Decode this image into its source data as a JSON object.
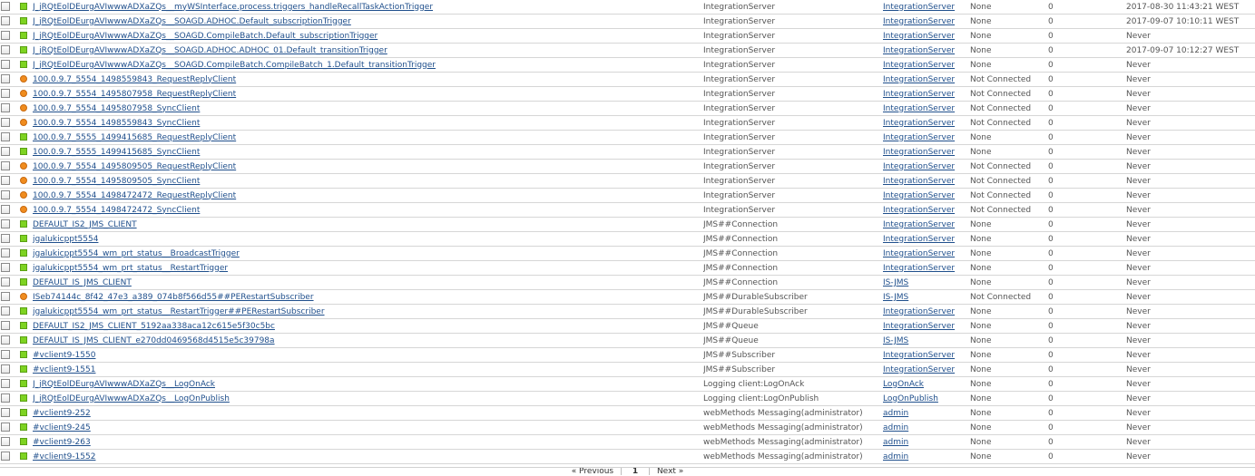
{
  "rows": [
    {
      "name": "J_jRQtEolDEurgAVIwwwADXaZQs__myWSInterface.process.triggers_handleRecallTaskActionTrigger",
      "type": "IntegrationServer",
      "realm": "IntegrationServer",
      "state": "None",
      "count": "0",
      "last": "2017-08-30 11:43:21 WEST",
      "status": "ok"
    },
    {
      "name": "J_jRQtEolDEurgAVIwwwADXaZQs__SOAGD.ADHOC.Default_subscriptionTrigger",
      "type": "IntegrationServer",
      "realm": "IntegrationServer",
      "state": "None",
      "count": "0",
      "last": "2017-09-07 10:10:11 WEST",
      "status": "ok"
    },
    {
      "name": "J_jRQtEolDEurgAVIwwwADXaZQs__SOAGD.CompileBatch.Default_subscriptionTrigger",
      "type": "IntegrationServer",
      "realm": "IntegrationServer",
      "state": "None",
      "count": "0",
      "last": "Never",
      "status": "ok"
    },
    {
      "name": "J_jRQtEolDEurgAVIwwwADXaZQs__SOAGD.ADHOC.ADHOC_01.Default_transitionTrigger",
      "type": "IntegrationServer",
      "realm": "IntegrationServer",
      "state": "None",
      "count": "0",
      "last": "2017-09-07 10:12:27 WEST",
      "status": "ok"
    },
    {
      "name": "J_jRQtEolDEurgAVIwwwADXaZQs__SOAGD.CompileBatch.CompileBatch_1.Default_transitionTrigger",
      "type": "IntegrationServer",
      "realm": "IntegrationServer",
      "state": "None",
      "count": "0",
      "last": "Never",
      "status": "ok"
    },
    {
      "name": "100.0.9.7_5554_1498559843_RequestReplyClient",
      "type": "IntegrationServer",
      "realm": "IntegrationServer",
      "state": "Not Connected",
      "count": "0",
      "last": "Never",
      "status": "warn"
    },
    {
      "name": "100.0.9.7_5554_1495807958_RequestReplyClient",
      "type": "IntegrationServer",
      "realm": "IntegrationServer",
      "state": "Not Connected",
      "count": "0",
      "last": "Never",
      "status": "warn"
    },
    {
      "name": "100.0.9.7_5554_1495807958_SyncClient",
      "type": "IntegrationServer",
      "realm": "IntegrationServer",
      "state": "Not Connected",
      "count": "0",
      "last": "Never",
      "status": "warn"
    },
    {
      "name": "100.0.9.7_5554_1498559843_SyncClient",
      "type": "IntegrationServer",
      "realm": "IntegrationServer",
      "state": "Not Connected",
      "count": "0",
      "last": "Never",
      "status": "warn"
    },
    {
      "name": "100.0.9.7_5555_1499415685_RequestReplyClient",
      "type": "IntegrationServer",
      "realm": "IntegrationServer",
      "state": "None",
      "count": "0",
      "last": "Never",
      "status": "ok"
    },
    {
      "name": "100.0.9.7_5555_1499415685_SyncClient",
      "type": "IntegrationServer",
      "realm": "IntegrationServer",
      "state": "None",
      "count": "0",
      "last": "Never",
      "status": "ok"
    },
    {
      "name": "100.0.9.7_5554_1495809505_RequestReplyClient",
      "type": "IntegrationServer",
      "realm": "IntegrationServer",
      "state": "Not Connected",
      "count": "0",
      "last": "Never",
      "status": "warn"
    },
    {
      "name": "100.0.9.7_5554_1495809505_SyncClient",
      "type": "IntegrationServer",
      "realm": "IntegrationServer",
      "state": "Not Connected",
      "count": "0",
      "last": "Never",
      "status": "warn"
    },
    {
      "name": "100.0.9.7_5554_1498472472_RequestReplyClient",
      "type": "IntegrationServer",
      "realm": "IntegrationServer",
      "state": "Not Connected",
      "count": "0",
      "last": "Never",
      "status": "warn"
    },
    {
      "name": "100.0.9.7_5554_1498472472_SyncClient",
      "type": "IntegrationServer",
      "realm": "IntegrationServer",
      "state": "Not Connected",
      "count": "0",
      "last": "Never",
      "status": "warn"
    },
    {
      "name": "DEFAULT_IS2_JMS_CLIENT",
      "type": "JMS##Connection",
      "realm": "IntegrationServer",
      "state": "None",
      "count": "0",
      "last": "Never",
      "status": "ok"
    },
    {
      "name": "jgalukicppt5554",
      "type": "JMS##Connection",
      "realm": "IntegrationServer",
      "state": "None",
      "count": "0",
      "last": "Never",
      "status": "ok"
    },
    {
      "name": "jgalukicppt5554_wm_prt_status__BroadcastTrigger",
      "type": "JMS##Connection",
      "realm": "IntegrationServer",
      "state": "None",
      "count": "0",
      "last": "Never",
      "status": "ok"
    },
    {
      "name": "jgalukicppt5554_wm_prt_status__RestartTrigger",
      "type": "JMS##Connection",
      "realm": "IntegrationServer",
      "state": "None",
      "count": "0",
      "last": "Never",
      "status": "ok"
    },
    {
      "name": "DEFAULT_IS_JMS_CLIENT",
      "type": "JMS##Connection",
      "realm": "IS-JMS",
      "state": "None",
      "count": "0",
      "last": "Never",
      "status": "ok"
    },
    {
      "name": "ISeb74144c_8f42_47e3_a389_074b8f566d55##PERestartSubscriber",
      "type": "JMS##DurableSubscriber",
      "realm": "IS-JMS",
      "state": "Not Connected",
      "count": "0",
      "last": "Never",
      "status": "warn"
    },
    {
      "name": "jgalukicppt5554_wm_prt_status__RestartTrigger##PERestartSubscriber",
      "type": "JMS##DurableSubscriber",
      "realm": "IntegrationServer",
      "state": "None",
      "count": "0",
      "last": "Never",
      "status": "ok"
    },
    {
      "name": "DEFAULT_IS2_JMS_CLIENT_5192aa338aca12c615e5f30c5bc",
      "type": "JMS##Queue",
      "realm": "IntegrationServer",
      "state": "None",
      "count": "0",
      "last": "Never",
      "status": "ok"
    },
    {
      "name": "DEFAULT_IS_JMS_CLIENT_e270dd0469568d4515e5c39798a",
      "type": "JMS##Queue",
      "realm": "IS-JMS",
      "state": "None",
      "count": "0",
      "last": "Never",
      "status": "ok"
    },
    {
      "name": "#vclient9-1550",
      "type": "JMS##Subscriber",
      "realm": "IntegrationServer",
      "state": "None",
      "count": "0",
      "last": "Never",
      "status": "ok"
    },
    {
      "name": "#vclient9-1551",
      "type": "JMS##Subscriber",
      "realm": "IntegrationServer",
      "state": "None",
      "count": "0",
      "last": "Never",
      "status": "ok"
    },
    {
      "name": "J_jRQtEolDEurgAVIwwwADXaZQs__LogOnAck",
      "type": "Logging client:LogOnAck",
      "realm": "LogOnAck",
      "state": "None",
      "count": "0",
      "last": "Never",
      "status": "ok"
    },
    {
      "name": "J_jRQtEolDEurgAVIwwwADXaZQs__LogOnPublish",
      "type": "Logging client:LogOnPublish",
      "realm": "LogOnPublish",
      "state": "None",
      "count": "0",
      "last": "Never",
      "status": "ok"
    },
    {
      "name": "#vclient9-252",
      "type": "webMethods Messaging(administrator)",
      "realm": "admin",
      "state": "None",
      "count": "0",
      "last": "Never",
      "status": "ok"
    },
    {
      "name": "#vclient9-245",
      "type": "webMethods Messaging(administrator)",
      "realm": "admin",
      "state": "None",
      "count": "0",
      "last": "Never",
      "status": "ok"
    },
    {
      "name": "#vclient9-263",
      "type": "webMethods Messaging(administrator)",
      "realm": "admin",
      "state": "None",
      "count": "0",
      "last": "Never",
      "status": "ok"
    },
    {
      "name": "#vclient9-1552",
      "type": "webMethods Messaging(administrator)",
      "realm": "admin",
      "state": "None",
      "count": "0",
      "last": "Never",
      "status": "ok"
    }
  ],
  "pager": {
    "prev": "« Previous",
    "sep": "|",
    "current": "1",
    "next": "Next »"
  },
  "colors": {
    "ok": "#7ed321",
    "warn": "#f08c1e",
    "link": "#1f4f8c"
  }
}
